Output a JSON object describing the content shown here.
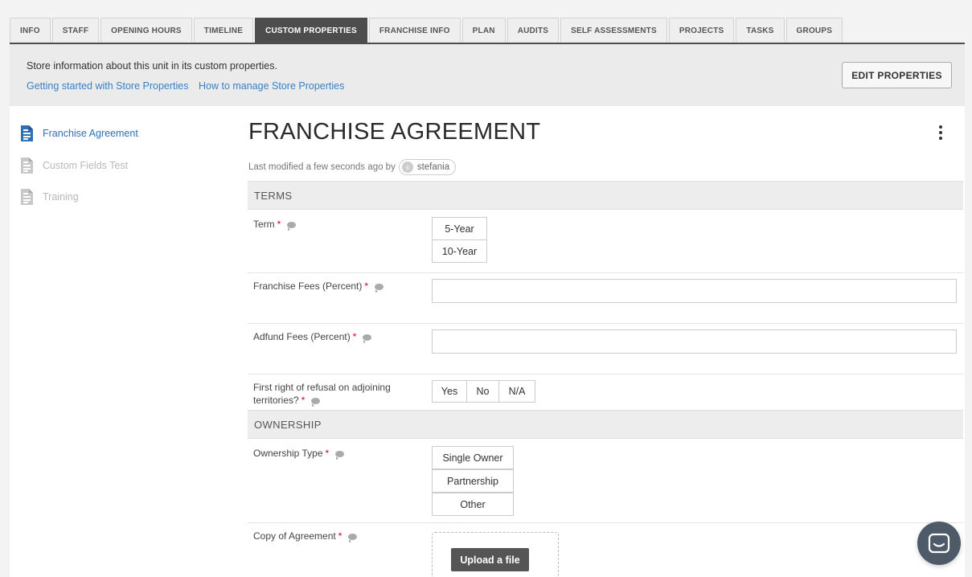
{
  "tabs": [
    {
      "label": "INFO",
      "active": false
    },
    {
      "label": "STAFF",
      "active": false
    },
    {
      "label": "OPENING HOURS",
      "active": false
    },
    {
      "label": "TIMELINE",
      "active": false
    },
    {
      "label": "CUSTOM PROPERTIES",
      "active": true
    },
    {
      "label": "FRANCHISE INFO",
      "active": false
    },
    {
      "label": "PLAN",
      "active": false
    },
    {
      "label": "AUDITS",
      "active": false
    },
    {
      "label": "SELF ASSESSMENTS",
      "active": false
    },
    {
      "label": "PROJECTS",
      "active": false
    },
    {
      "label": "TASKS",
      "active": false
    },
    {
      "label": "GROUPS",
      "active": false
    }
  ],
  "info": {
    "text": "Store information about this unit in its custom properties.",
    "link1": "Getting started with Store Properties",
    "link2": "How to manage Store Properties",
    "edit_button": "EDIT PROPERTIES"
  },
  "sidebar": {
    "items": [
      {
        "label": "Franchise Agreement",
        "icon": "document-icon",
        "active": true
      },
      {
        "label": "Custom Fields Test",
        "icon": "document-icon",
        "active": false
      },
      {
        "label": "Training",
        "icon": "document-icon",
        "active": false
      }
    ]
  },
  "content": {
    "title": "FRANCHISE AGREEMENT",
    "modified_text": "Last modified a few seconds ago by",
    "user_initial": "s",
    "user_name": "stefania"
  },
  "sections": {
    "terms": "TERMS",
    "ownership": "OWNERSHIP"
  },
  "fields": {
    "term": {
      "label": "Term",
      "options": [
        "5-Year",
        "10-Year"
      ]
    },
    "franchise_fees": {
      "label": "Franchise Fees (Percent)",
      "value": ""
    },
    "adfund_fees": {
      "label": "Adfund Fees (Percent)",
      "value": ""
    },
    "first_right": {
      "label_line1": "First right of refusal on adjoining",
      "label_line2": "territories?",
      "options": [
        "Yes",
        "No",
        "N/A"
      ]
    },
    "ownership_type": {
      "label": "Ownership Type",
      "options": [
        "Single Owner",
        "Partnership",
        "Other"
      ]
    },
    "copy_of_agreement": {
      "label": "Copy of Agreement",
      "upload_label": "Upload a file"
    }
  },
  "required_marker": "*",
  "colors": {
    "accent": "#2f6fb5",
    "link": "#3a80c4",
    "active_tab": "#4d4d4d",
    "required": "#d0021b",
    "chat": "#4e5a68"
  }
}
